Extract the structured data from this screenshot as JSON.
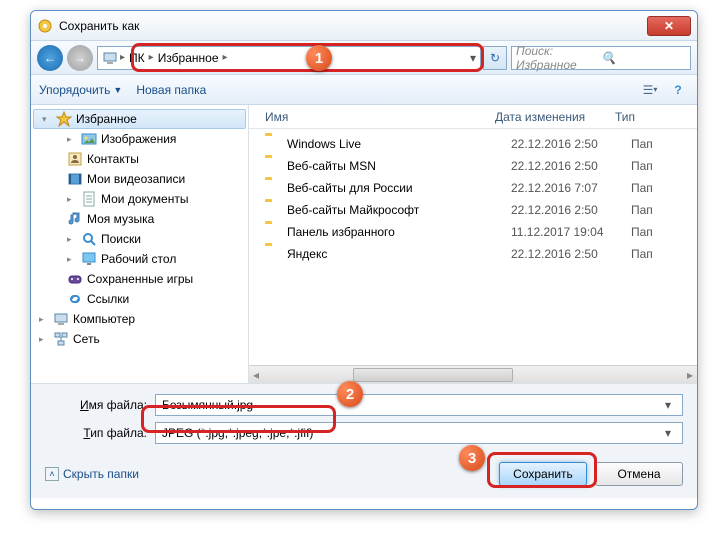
{
  "window": {
    "title": "Сохранить как"
  },
  "breadcrumb": {
    "root": "ПК",
    "folder": "Избранное"
  },
  "search": {
    "placeholder": "Поиск: Избранное"
  },
  "toolbar": {
    "organize": "Упорядочить",
    "newfolder": "Новая папка"
  },
  "tree": {
    "favorites": "Избранное",
    "images": "Изображения",
    "contacts": "Контакты",
    "videos": "Мои видеозаписи",
    "documents": "Мои документы",
    "music": "Моя музыка",
    "searches": "Поиски",
    "desktop": "Рабочий стол",
    "savedgames": "Сохраненные игры",
    "links": "Ссылки",
    "computer": "Компьютер",
    "network": "Сеть"
  },
  "columns": {
    "name": "Имя",
    "date": "Дата изменения",
    "type": "Тип"
  },
  "files": [
    {
      "name": "Windows Live",
      "date": "22.12.2016 2:50",
      "type": "Пап"
    },
    {
      "name": "Веб-сайты MSN",
      "date": "22.12.2016 2:50",
      "type": "Пап"
    },
    {
      "name": "Веб-сайты для России",
      "date": "22.12.2016 7:07",
      "type": "Пап"
    },
    {
      "name": "Веб-сайты Майкрософт",
      "date": "22.12.2016 2:50",
      "type": "Пап"
    },
    {
      "name": "Панель избранного",
      "date": "11.12.2017 19:04",
      "type": "Пап"
    },
    {
      "name": "Яндекс",
      "date": "22.12.2016 2:50",
      "type": "Пап"
    }
  ],
  "filename": {
    "label": "Имя файла:",
    "value": "Безымянный.jpg"
  },
  "filetype": {
    "label": "Тип файла:",
    "value": "JPEG (*.jpg;*.jpeg;*.jpe;*.jfif)"
  },
  "footer": {
    "hidefolders": "Скрыть папки",
    "save": "Сохранить",
    "cancel": "Отмена"
  },
  "badges": {
    "b1": "1",
    "b2": "2",
    "b3": "3"
  }
}
